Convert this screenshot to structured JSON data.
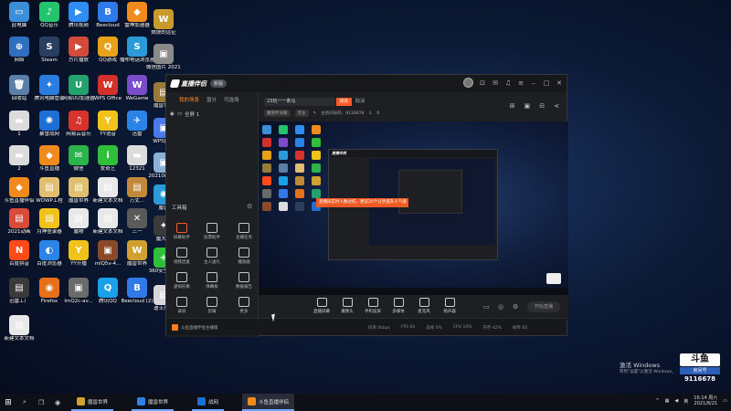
{
  "desktop": {
    "icons": [
      {
        "label": "此电脑",
        "color": "#3a8fd8",
        "glyph": "▭"
      },
      {
        "label": "QQ音乐",
        "color": "#24c46f",
        "glyph": "♪"
      },
      {
        "label": "腾讯视频",
        "color": "#2f8cf2",
        "glyph": "▶"
      },
      {
        "label": "Beecloud",
        "color": "#2f7ae8",
        "glyph": "B"
      },
      {
        "label": "雷神加速器",
        "color": "#f08a1c",
        "glyph": "◆"
      },
      {
        "label": "燃烧的远征",
        "color": "#c89a2e",
        "glyph": "W"
      },
      {
        "label": "网络",
        "color": "#2e6fbf",
        "glyph": "⊕"
      },
      {
        "label": "Steam",
        "color": "#2a3f5f",
        "glyph": "S"
      },
      {
        "label": "方片播放",
        "color": "#d14a3a",
        "glyph": "▶"
      },
      {
        "label": "QQ游戏",
        "color": "#e8a219",
        "glyph": "Q"
      },
      {
        "label": "播布电话浏览器",
        "color": "#2a9ad8",
        "glyph": "S"
      },
      {
        "label": "微信图片 20210811...",
        "color": "#8a8a8a",
        "glyph": "▣"
      },
      {
        "label": "回收站",
        "color": "#5b7fa8",
        "glyph": "🗑"
      },
      {
        "label": "腾讯电脑管家",
        "color": "#2a7ce0",
        "glyph": "✦"
      },
      {
        "label": "网易UU加速器",
        "color": "#22a36e",
        "glyph": "U"
      },
      {
        "label": "WPS Office",
        "color": "#d4302b",
        "glyph": "W"
      },
      {
        "label": "WeGame",
        "color": "#7a4ccc",
        "glyph": "W"
      },
      {
        "label": "魔兽世界",
        "color": "#9a7a3a",
        "glyph": "▤"
      },
      {
        "label": "1",
        "color": "#dcdcdc",
        "glyph": "▬"
      },
      {
        "label": "暴雪战网",
        "color": "#1d6fd6",
        "glyph": "✺"
      },
      {
        "label": "网易云音乐",
        "color": "#d8322c",
        "glyph": "♫"
      },
      {
        "label": "YY语音",
        "color": "#f0c21a",
        "glyph": "Y"
      },
      {
        "label": "迅雷",
        "color": "#2a84e8",
        "glyph": "✈"
      },
      {
        "label": "WPS图片",
        "color": "#4a7ae8",
        "glyph": "▣"
      },
      {
        "label": "2",
        "color": "#dcdcdc",
        "glyph": "▬"
      },
      {
        "label": "斗鱼直播",
        "color": "#f08a1c",
        "glyph": "◆"
      },
      {
        "label": "微信",
        "color": "#2bb44a",
        "glyph": "✉"
      },
      {
        "label": "爱奇艺",
        "color": "#2fbf3a",
        "glyph": "i"
      },
      {
        "label": "12321",
        "color": "#dcdcdc",
        "glyph": "▬"
      },
      {
        "label": "20210811...",
        "color": "#8ab0d8",
        "glyph": "▣"
      },
      {
        "label": "斗鱼直播伴侣",
        "color": "#f08a1c",
        "glyph": "◆"
      },
      {
        "label": "WOWP工程",
        "color": "#e0c070",
        "glyph": "▤"
      },
      {
        "label": "魔兽世界",
        "color": "#e0c070",
        "glyph": "▤"
      },
      {
        "label": "新建文本文档",
        "color": "#e8e8e8",
        "glyph": "▤"
      },
      {
        "label": "万丈...",
        "color": "#c08a3a",
        "glyph": "▤"
      },
      {
        "label": "魔兽",
        "color": "#2a9ad8",
        "glyph": "✺"
      },
      {
        "label": "2021动画",
        "color": "#d84a3a",
        "glyph": "▤"
      },
      {
        "label": "月神登录器",
        "color": "#f0c21a",
        "glyph": "▤"
      },
      {
        "label": "魔物",
        "color": "#e8e8e8",
        "glyph": "▤"
      },
      {
        "label": "新建文本文档",
        "color": "#e8e8e8",
        "glyph": "▤"
      },
      {
        "label": "三一",
        "color": "#5a5a5a",
        "glyph": "✕"
      },
      {
        "label": "魔大佬",
        "color": "#3a3a3a",
        "glyph": "✦"
      },
      {
        "label": "百度拼音",
        "color": "#ff4a1a",
        "glyph": "N"
      },
      {
        "label": "百度浏览器",
        "color": "#2a84e8",
        "glyph": "◐"
      },
      {
        "label": "YY开播",
        "color": "#f0c21a",
        "glyph": "Y"
      },
      {
        "label": "mlQ5v-4...",
        "color": "#8a4a2a",
        "glyph": "▣"
      },
      {
        "label": "魔兽世界",
        "color": "#d0a030",
        "glyph": "W"
      },
      {
        "label": "360安全卫士",
        "color": "#2fbf3a",
        "glyph": "+"
      },
      {
        "label": "迅雷工厂",
        "color": "#3a3a3a",
        "glyph": "▤"
      },
      {
        "label": "Firefox",
        "color": "#e8701a",
        "glyph": "◉"
      },
      {
        "label": "ImQ2c-av...",
        "color": "#6a6a6a",
        "glyph": "▣"
      },
      {
        "label": "腾讯QQ",
        "color": "#1aa0e8",
        "glyph": "Q"
      },
      {
        "label": "Beecloud (2)",
        "color": "#2f7ae8",
        "glyph": "B"
      },
      {
        "label": "迪士尼图",
        "color": "#d8d8d8",
        "glyph": "▤"
      },
      {
        "label": "新建文本文档",
        "color": "#e8e8e8",
        "glyph": "▤"
      }
    ]
  },
  "app": {
    "name": "直播伴侣",
    "version_badge": "新版",
    "scene_tabs": [
      "我的场景",
      "窗分",
      "可选场"
    ],
    "scene_item": "全屏 1",
    "tools_title": "工具箱",
    "tools": [
      {
        "label": "屏幕助手"
      },
      {
        "label": "投票助手"
      },
      {
        "label": "主播任务"
      },
      {
        "label": "视频连麦"
      },
      {
        "label": "主人送礼"
      },
      {
        "label": "播放器"
      },
      {
        "label": "虚拟形象"
      },
      {
        "label": "弹幕板"
      },
      {
        "label": "数据报告"
      },
      {
        "label": "录屏"
      },
      {
        "label": "剪辑"
      },
      {
        "label": "更多"
      }
    ],
    "header": {
      "room_title": "23玩一一条马",
      "modify_label": "修改",
      "cancel_label": "取消",
      "category_label": "魔兽怀旧服",
      "tag_label": "求主",
      "room_no_label": "主房间号码：9116678",
      "online_count": "0"
    },
    "preview": {
      "notice_text": "直播间实时人数过低，建议20个分享提升人气值"
    },
    "controls": [
      {
        "label": "直播屏幕"
      },
      {
        "label": "摄像头"
      },
      {
        "label": "手机投屏"
      },
      {
        "label": "多媒体"
      },
      {
        "label": "麦克风"
      },
      {
        "label": "扬声器"
      }
    ],
    "start_live_label": "开始直播",
    "status": {
      "text": "斗鱼直播伴侣主播版",
      "metrics": [
        "码率 0kbps",
        "FPS 60",
        "丢帧 0%",
        "CPU 10%",
        "内存 42%",
        "帧率 60"
      ]
    }
  },
  "watermark": {
    "activate_title": "激活 Windows",
    "activate_sub": "转到\"设置\"以激活 Windows。",
    "douyu_logo": "斗鱼",
    "douyu_tag": "房间号",
    "room_number": "9116678"
  },
  "taskbar": {
    "start_glyph": "⊞",
    "apps": [
      {
        "label": "魔兽世界",
        "color": "#d0a030"
      },
      {
        "label": "魔兽世界",
        "color": "#2a84e8"
      },
      {
        "label": "战网",
        "color": "#1d6fd6"
      },
      {
        "label": "斗鱼直播伴侣",
        "color": "#f08a1c",
        "active": true
      }
    ],
    "time": "16:14 周六",
    "date": "2021/8/21",
    "ime": "英"
  }
}
